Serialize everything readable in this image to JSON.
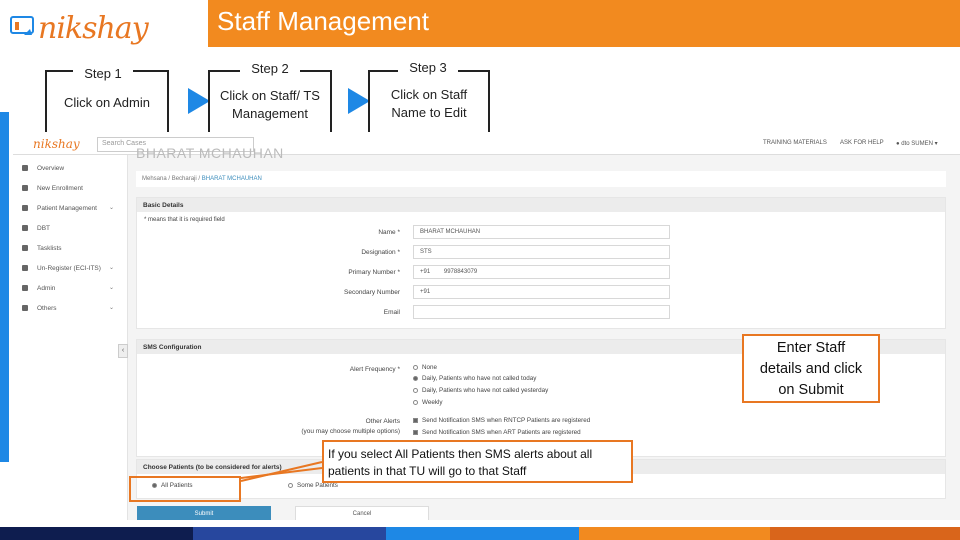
{
  "slide": {
    "logo_text": "nikshay",
    "title": "Staff Management",
    "colors": {
      "accent_orange": "#f28a1f",
      "accent_blue": "#1e88e5",
      "navy": "#0e1d4f"
    }
  },
  "steps": [
    {
      "label": "Step 1",
      "desc_line1": "Click on Admin",
      "desc_line2": ""
    },
    {
      "label": "Step 2",
      "desc_line1": "Click on Staff/ TS",
      "desc_line2": "Management"
    },
    {
      "label": "Step 3",
      "desc_line1": "Click on Staff",
      "desc_line2": "Name to Edit"
    }
  ],
  "app": {
    "logo": "nikshay",
    "search_placeholder": "Search Cases",
    "top_links": {
      "training": "TRAINING MATERIALS",
      "help": "ASK FOR HELP",
      "user": "● dto SUMEN ▾"
    },
    "sidebar": [
      {
        "label": "Overview",
        "icon": "grid-icon",
        "chevron": ""
      },
      {
        "label": "New Enrollment",
        "icon": "plus-icon",
        "chevron": ""
      },
      {
        "label": "Patient Management",
        "icon": "folder-icon",
        "chevron": "⌄"
      },
      {
        "label": "DBT",
        "icon": "money-icon",
        "chevron": ""
      },
      {
        "label": "Tasklists",
        "icon": "list-icon",
        "chevron": ""
      },
      {
        "label": "Un-Register (ECI-ITS)",
        "icon": "user-minus-icon",
        "chevron": "⌄"
      },
      {
        "label": "Admin",
        "icon": "person-icon",
        "chevron": "⌄"
      },
      {
        "label": "Others",
        "icon": "dots-icon",
        "chevron": "⌄"
      }
    ],
    "collapse_glyph": "‹",
    "page_heading": "BHARAT MCHAUHAN",
    "breadcrumb": {
      "a": "Mehsana",
      "sep": "/",
      "b": "Becharaji",
      "c": "BHARAT MCHAUHAN"
    },
    "basic_details": {
      "header": "Basic Details",
      "note": "* means that it is required field",
      "fields": [
        {
          "label": "Name *",
          "value": "BHARAT MCHAUHAN",
          "prefix": ""
        },
        {
          "label": "Designation *",
          "value": "STS",
          "prefix": ""
        },
        {
          "label": "Primary Number *",
          "value": "9978843079",
          "prefix": "+91"
        },
        {
          "label": "Secondary Number",
          "value": "",
          "prefix": "+91"
        },
        {
          "label": "Email",
          "value": "",
          "prefix": ""
        }
      ]
    },
    "sms_config": {
      "header": "SMS Configuration",
      "frequency_label": "Alert Frequency *",
      "frequency_options": [
        {
          "label": "None",
          "checked": false
        },
        {
          "label": "Daily, Patients who have not called today",
          "checked": true
        },
        {
          "label": "Daily, Patients who have not called yesterday",
          "checked": false
        },
        {
          "label": "Weekly",
          "checked": false
        }
      ],
      "other_label_line1": "Other Alerts",
      "other_label_line2": "(you may choose multiple options)",
      "other_options": [
        {
          "label": "Send Notification SMS when RNTCP Patients are registered",
          "checked": true
        },
        {
          "label": "Send Notification SMS when ART Patients are registered",
          "checked": true
        }
      ]
    },
    "choose_patients": {
      "header": "Choose Patients (to be considered for alerts)",
      "options": [
        {
          "label": "All Patients",
          "checked": true
        },
        {
          "label": "Some Patients",
          "checked": false
        }
      ]
    },
    "buttons": {
      "submit": "Submit",
      "cancel": "Cancel"
    }
  },
  "callouts": {
    "staff_line1": "Enter Staff",
    "staff_line2": "details and click",
    "staff_line3": "on Submit",
    "alerts_line1": "If you select All Patients then SMS alerts about all",
    "alerts_line2": "patients in that TU will go to that Staff"
  }
}
